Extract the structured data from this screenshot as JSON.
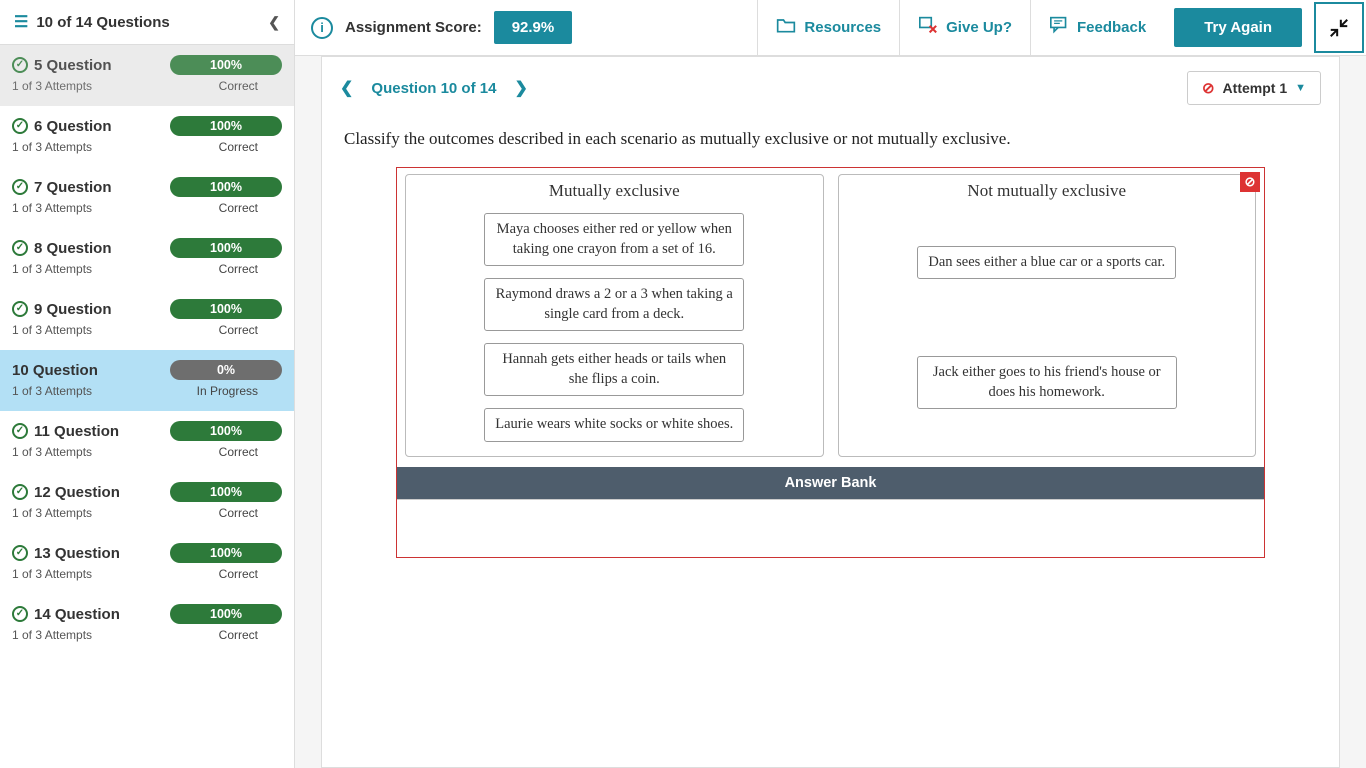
{
  "sidebar": {
    "header": "10 of 14 Questions",
    "items": [
      {
        "name": "5 Question",
        "attempts": "1 of 3 Attempts",
        "score": "100%",
        "status": "Correct",
        "style": "green",
        "check": true,
        "dim": true
      },
      {
        "name": "6 Question",
        "attempts": "1 of 3 Attempts",
        "score": "100%",
        "status": "Correct",
        "style": "green",
        "check": true
      },
      {
        "name": "7 Question",
        "attempts": "1 of 3 Attempts",
        "score": "100%",
        "status": "Correct",
        "style": "green",
        "check": true
      },
      {
        "name": "8 Question",
        "attempts": "1 of 3 Attempts",
        "score": "100%",
        "status": "Correct",
        "style": "green",
        "check": true
      },
      {
        "name": "9 Question",
        "attempts": "1 of 3 Attempts",
        "score": "100%",
        "status": "Correct",
        "style": "green",
        "check": true
      },
      {
        "name": "10 Question",
        "attempts": "1 of 3 Attempts",
        "score": "0%",
        "status": "In Progress",
        "style": "gray",
        "check": false,
        "active": true
      },
      {
        "name": "11 Question",
        "attempts": "1 of 3 Attempts",
        "score": "100%",
        "status": "Correct",
        "style": "green",
        "check": true
      },
      {
        "name": "12 Question",
        "attempts": "1 of 3 Attempts",
        "score": "100%",
        "status": "Correct",
        "style": "green",
        "check": true
      },
      {
        "name": "13 Question",
        "attempts": "1 of 3 Attempts",
        "score": "100%",
        "status": "Correct",
        "style": "green",
        "check": true
      },
      {
        "name": "14 Question",
        "attempts": "1 of 3 Attempts",
        "score": "100%",
        "status": "Correct",
        "style": "green",
        "check": true
      }
    ]
  },
  "toolbar": {
    "score_label": "Assignment Score:",
    "score_value": "92.9%",
    "resources": "Resources",
    "giveup": "Give Up?",
    "feedback": "Feedback",
    "try_again": "Try Again"
  },
  "qnav": {
    "title": "Question 10 of 14",
    "attempt": "Attempt 1"
  },
  "prompt": "Classify the outcomes described in each scenario as mutually exclusive or not mutually exclusive.",
  "zones": {
    "left_title": "Mutually exclusive",
    "right_title": "Not mutually exclusive",
    "left_items": [
      "Maya chooses either red or yellow when taking one crayon from a set of 16.",
      "Raymond draws a 2 or a 3 when taking a single card from a deck.",
      "Hannah gets either heads or tails when she flips a coin.",
      "Laurie wears white socks or white shoes."
    ],
    "right_items": [
      "Dan sees either a blue car or a sports car.",
      "Jack either goes to his friend's house or does his homework."
    ]
  },
  "answer_bank": "Answer Bank"
}
